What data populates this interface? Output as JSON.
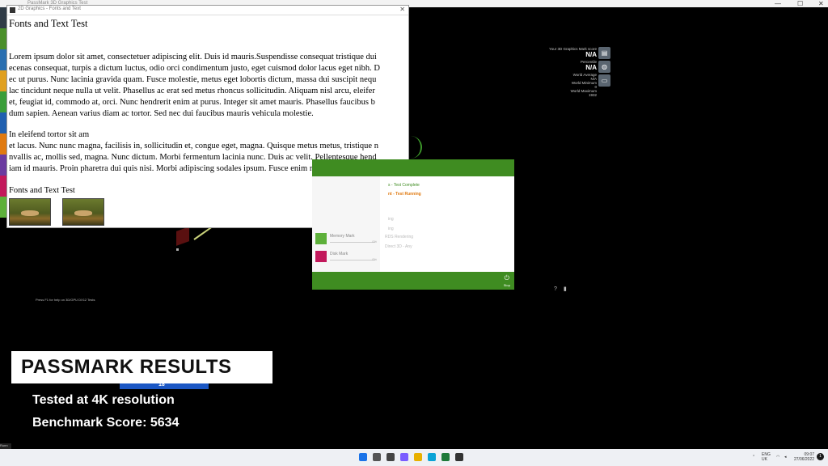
{
  "underlying_app": {
    "title": "PassMark 3D Graphics Test",
    "window_controls": [
      "—",
      "☐",
      "✕"
    ]
  },
  "test_window": {
    "title": "2D Graphics - Fonts and Text",
    "close": "✕",
    "heading": "Fonts and Text Test",
    "paragraph1": [
      "Lorem ipsum dolor sit amet, consectetuer adipiscing elit. Duis id mauris.Suspendisse consequat tristique dui",
      "ecenas consequat, turpis a dictum luctus, odio orci condimentum justo, eget cuismod dolor lacus eget nibh. D",
      "ec ut purus. Nunc lacinia gravida quam. Fusce molestie, metus eget lobortis dictum, massa dui suscipit nequ",
      "lac tincidunt neque nulla ut velit. Phasellus ac erat sed metus rhoncus sollicitudin. Aliquam nisl arcu, eleifer",
      "et, feugiat id, commodo at, orci. Nunc hendrerit enim at purus. Integer sit amet mauris. Phasellus faucibus b",
      "dum sapien. Aenean varius diam ac tortor. Sed nec dui faucibus mauris vehicula molestie."
    ],
    "paragraph2": [
      "In eleifend tortor sit am",
      "et lacus. Nunc nunc magna, facilisis in, sollicitudin et, congue eget, magna. Quisque metus metus, tristique n",
      "nvallis ac, mollis sed, magna. Nunc dictum. Morbi fermentum lacinia nunc. Duis ac velit. Pellentesque hend",
      "iam id mauris. Proin pharetra dui quis nisi. Morbi adipiscing sodales ipsum. Fusce enim nullam."
    ],
    "footer_heading": "Fonts and Text Test"
  },
  "passmark_panel": {
    "status_lines": [
      {
        "text": "s - Test Complete",
        "color": "#3f8c21"
      },
      {
        "text": "nt - Test Running",
        "color": "#e07a10"
      },
      {
        "text": "ing",
        "color": "#bbbbbb"
      },
      {
        "text": "ing",
        "color": "#bbbbbb"
      }
    ],
    "right_items": [
      "RDS Rendering",
      "Direct 3D - Any"
    ],
    "tests": [
      {
        "label": "Memory Mark",
        "pct": "0%",
        "color": "#5db03a"
      },
      {
        "label": "Disk Mark",
        "pct": "0%",
        "color": "#c2185b"
      }
    ],
    "footer_label": "Stop"
  },
  "stats": {
    "score_label": "Your 3D Graphics Mark score",
    "score_value": "N/A",
    "percentile_label": "Percentile",
    "percentile_value": "N/A",
    "world_average_label": "World Average",
    "world_average_value": "N/A",
    "world_minimum_label": "World Minimum",
    "world_minimum_value": "0",
    "world_maximum_label": "World Maximum",
    "world_maximum_value": "1932"
  },
  "small_info": "Press F1 for help on 3D/GPU DX12 Tests",
  "overlay": {
    "title": "PASSMARK RESULTS",
    "line1": "Tested at 4K resolution",
    "line2": "Benchmark Score: 5634",
    "bar_number": "18"
  },
  "bottom_left": "Runn",
  "taskbar": {
    "lang_top": "ENG",
    "lang_bottom": "UK",
    "time": "09:07",
    "date": "27/06/2022",
    "notification_count": "1"
  }
}
